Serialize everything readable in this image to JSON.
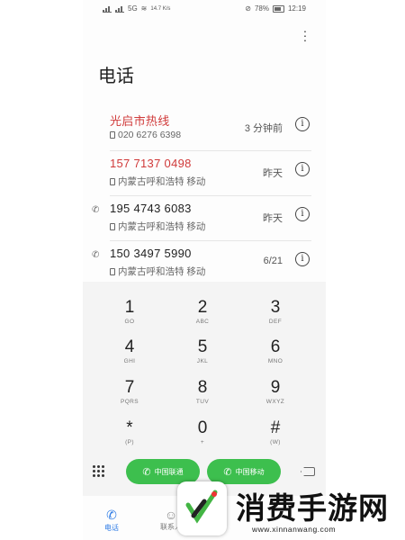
{
  "status_bar": {
    "left_text": "5G",
    "speed": "14.7 K/s",
    "battery": "78%",
    "time": "12:19"
  },
  "header": {
    "title": "电话"
  },
  "calls": [
    {
      "name": "光启市热线",
      "number_line": "020 6276 6398",
      "time": "3 分钟前",
      "missed": true,
      "outgoing": false
    },
    {
      "name": "157 7137 0498",
      "number_line": "内蒙古呼和浩特 移动",
      "time": "昨天",
      "missed": true,
      "outgoing": false
    },
    {
      "name": "195 4743 6083",
      "number_line": "内蒙古呼和浩特 移动",
      "time": "昨天",
      "missed": false,
      "outgoing": true
    },
    {
      "name": "150 3497 5990",
      "number_line": "内蒙古呼和浩特 移动",
      "time": "6/21",
      "missed": false,
      "outgoing": true
    }
  ],
  "keys": [
    {
      "d": "1",
      "l": "GO"
    },
    {
      "d": "2",
      "l": "ABC"
    },
    {
      "d": "3",
      "l": "DEF"
    },
    {
      "d": "4",
      "l": "GHI"
    },
    {
      "d": "5",
      "l": "JKL"
    },
    {
      "d": "6",
      "l": "MNO"
    },
    {
      "d": "7",
      "l": "PQRS"
    },
    {
      "d": "8",
      "l": "TUV"
    },
    {
      "d": "9",
      "l": "WXYZ"
    },
    {
      "d": "*",
      "l": "(P)"
    },
    {
      "d": "0",
      "l": "+"
    },
    {
      "d": "#",
      "l": "(W)"
    }
  ],
  "actions": {
    "call1_label": "中国联通",
    "call2_label": "中国移动"
  },
  "tabs": [
    {
      "label": "电话",
      "icon": "phone-icon",
      "active": true
    },
    {
      "label": "联系人",
      "icon": "contacts-icon",
      "active": false
    }
  ],
  "watermark": {
    "text": "消费手游网",
    "url": "www.xinnanwang.com"
  },
  "colors": {
    "missed": "#d03a3a",
    "call_button": "#3dbf4e",
    "active_tab": "#2d7be5"
  }
}
